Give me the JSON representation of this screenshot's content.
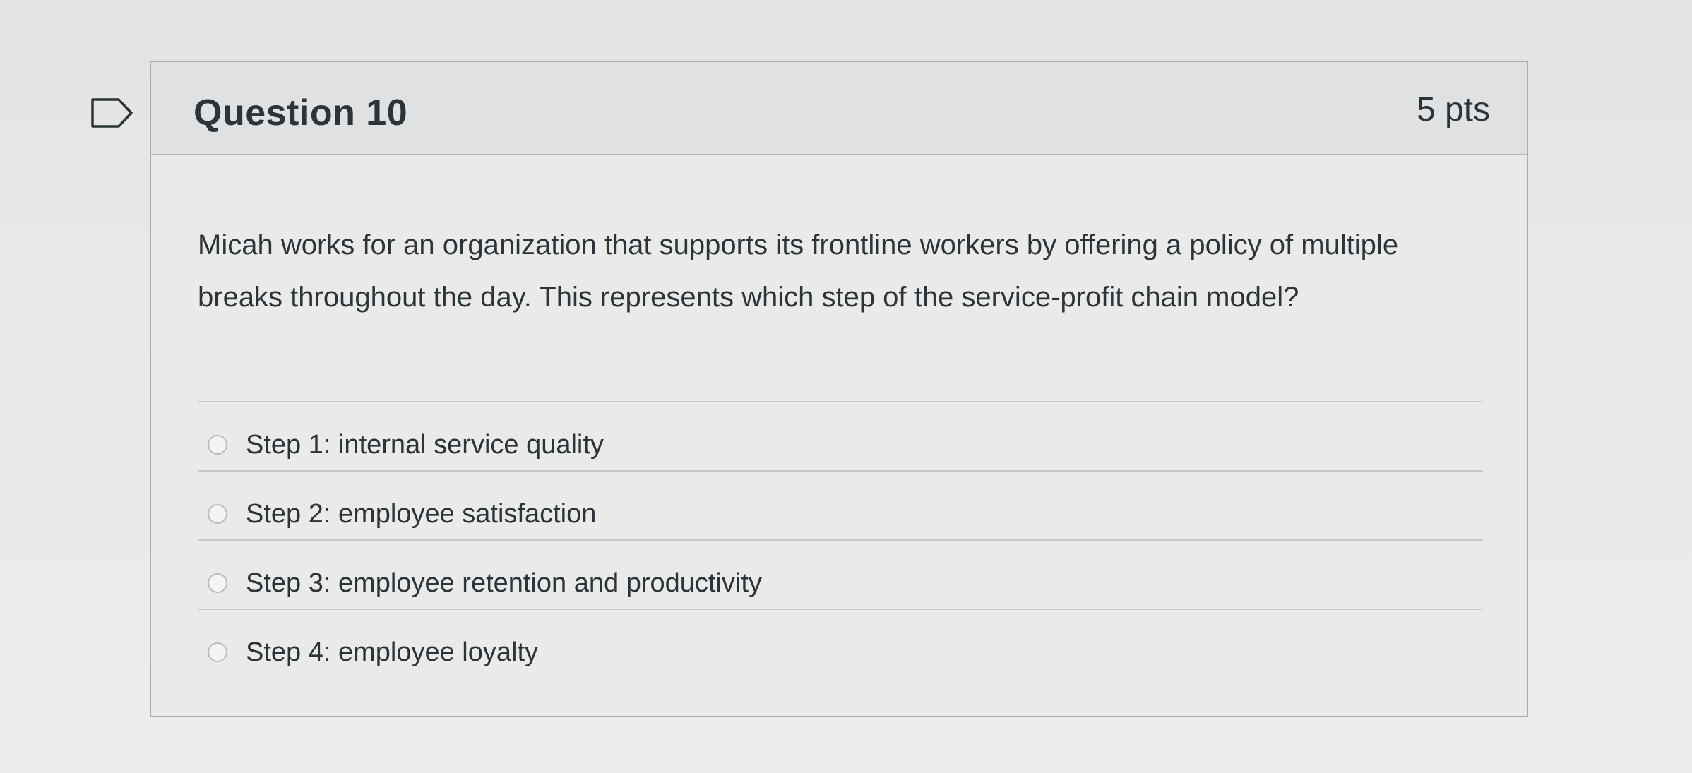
{
  "question": {
    "title": "Question 10",
    "points": "5 pts",
    "text": "Micah works for an organization that supports its frontline workers by offering a policy of multiple breaks throughout the day. This represents which step of the service-profit chain model?",
    "answers": [
      {
        "label": "Step 1: internal service quality",
        "selected": false
      },
      {
        "label": "Step 2: employee satisfaction",
        "selected": false
      },
      {
        "label": "Step 3: employee retention and productivity",
        "selected": false
      },
      {
        "label": "Step 4: employee loyalty",
        "selected": false
      }
    ]
  },
  "icons": {
    "flag": "flag-question-icon",
    "radio": "radio-button-icon"
  },
  "colors": {
    "text": "#2b3438",
    "border": "#a9acae",
    "header_bg": "#e0e1e2"
  }
}
